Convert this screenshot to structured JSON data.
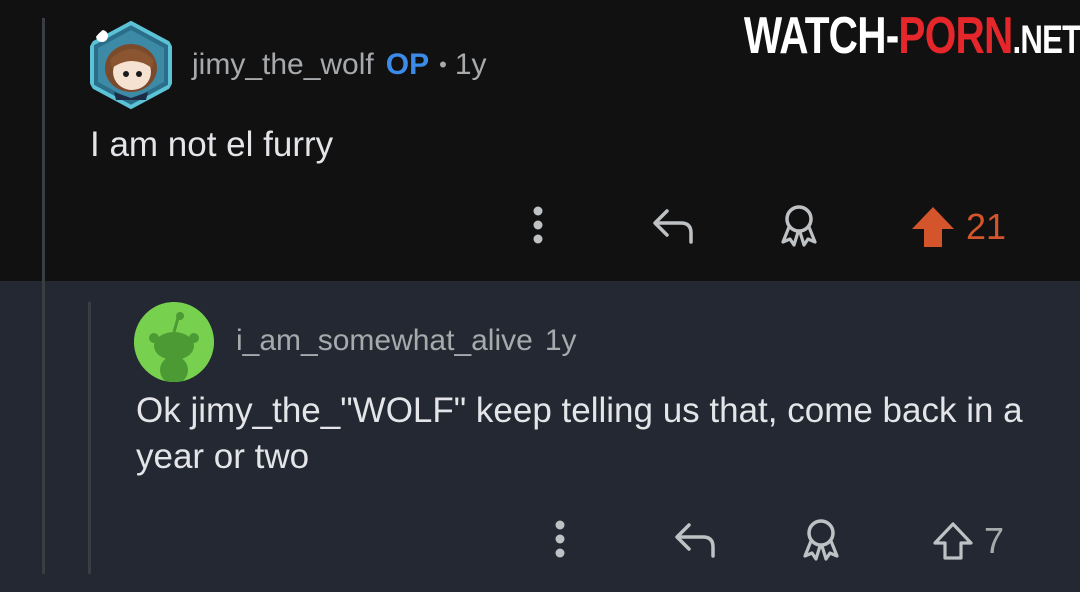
{
  "top_comment": {
    "username": "jimy_the_wolf",
    "op_badge": "OP",
    "separator": "•",
    "age": "1y",
    "body": "I am not el furry",
    "vote_count": "21",
    "upvoted": true
  },
  "reply": {
    "username": "i_am_somewhat_alive",
    "age": "1y",
    "body": "Ok jimy_the_\"WOLF\" keep telling us that, come back in a year or two",
    "vote_count": "7",
    "upvoted": false
  },
  "watermark": {
    "part1": "WATCH-",
    "part2": "PORN",
    "part3": ".NET"
  },
  "colors": {
    "upvote_active": "#d4542b",
    "op_badge": "#3c8be8",
    "reply_avatar_bg": "#78d04f",
    "watermark_red": "#e5262a"
  },
  "icons": {
    "more": "more-options-icon",
    "reply": "reply-arrow-icon",
    "award": "award-icon",
    "upvote": "upvote-arrow-icon"
  }
}
